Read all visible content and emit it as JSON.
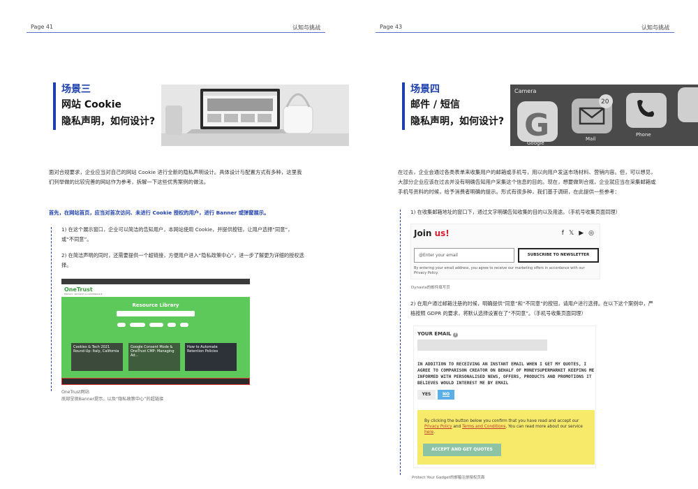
{
  "left": {
    "page_label": "Page 41",
    "header_title": "认知与挑战",
    "scene": "场景三",
    "title_line2": "网站 Cookie",
    "title_line3": "隐私声明，如何设计?",
    "intro": "面对合规要求，企业应当对自己的网站 Cookie 进行全新的隐私声明设计。具体设计与配置方式有多种，这里我们列举做的比较完善的网站作为参考，拆解一下这些优秀案例的做法。",
    "highlight": "首先，在网站首页，应当对首次访问、未进行 Cookie 授权的用户，进行 Banner 或弹窗展示。",
    "item1": "1) 在这个展示窗口，企业可以简洁的告知用户，本网站使用 Cookie，并提供按钮，让用户选择“同意”，或“不同意”。",
    "item2": "2) 在简洁声明的同时，还需要提供一个超链接，方便用户进入“隐私政策中心”，进一步了解更为详细的授权选择。",
    "caption1": "OneTrust网站",
    "caption2": "底部呈现Banner提示，以及“隐私政策中心”的超链接",
    "onetrust": {
      "logo": "OneTrust",
      "logo_sub": "PRIVACY, SECURITY & GOVERNANCE",
      "title": "Resource Library",
      "card1": "Cookies & Tech 2021 Round-Up: Italy, California",
      "card2": "Google Consent Mode & OneTrust CMP: Managing Ad...",
      "card3": "How to Automate Retention Policies"
    }
  },
  "right": {
    "page_label": "Page 43",
    "header_title": "认知与挑战",
    "scene": "场景四",
    "title_line2": "邮件 / 短信",
    "title_line3": "隐私声明，如何设计?",
    "intro": "在过去，企业会通过各类表单来收集用户的邮箱或手机号，用以向用户发送市场材料、营销内容。但，可以想见，大部分企业应该在过去并没有明确告知用户采集这个信息的目的。现在，想要做到合规，企业就应当在采集邮箱或手机号资料的时候，给予消费者明确的提示。形式有很多种，我们基于调研，在此提供一些参考：",
    "item1": "1) 在收集邮箱地址的窗口下，通过文字明确告知收集的目的以及用途。（手机号收集页面同理）",
    "item2": "2) 在用户通过邮箱注册的时候，明确提供“同意”和“不同意”的按钮，请用户进行选择。在以下这个案例中，严格按照 GDPR 的要求，将默认选择设置在了“不同意”。（手机号收集页面同理）",
    "caption_join": "Dynasta的邮件填写页",
    "caption_gdpr": "Protect Your Gadget的邮箱注册授权页面",
    "hero_labels": {
      "camera": "Camera",
      "google": "Google",
      "mail": "Mail",
      "phone": "Phone",
      "badge": "20"
    },
    "join": {
      "title_a": "Join",
      "title_b": "us!",
      "placeholder": "@Enter your email",
      "button": "SUBSCRIBE TO NEWSLETTER",
      "disclaimer": "By entering your email address, you agree to receive our marketing offers in accordance with our Privacy Policy."
    },
    "gdpr": {
      "label": "YOUR EMAIL",
      "text": "IN ADDITION TO RECEIVING AN INSTANT EMAIL WHEN I GET MY QUOTES, I AGREE TO COMPARISON CREATOR ON BEHALF OF MONEYSUPERMARKET KEEPING ME INFORMED WITH PERSONALISED NEWS, OFFERS, PRODUCTS AND PROMOTIONS IT BELIEVES WOULD INTEREST ME BY EMAIL",
      "yes": "YES",
      "no": "NO",
      "consent_a": "By clicking the button below you confirm that you have read and accept our",
      "privacy_link": "Privacy Policy",
      "and": "and",
      "terms_link": "Terms and Conditions",
      "consent_b": ". You can read more about our service",
      "here_link": "here",
      "button": "ACCEPT AND GET QUOTES"
    }
  }
}
